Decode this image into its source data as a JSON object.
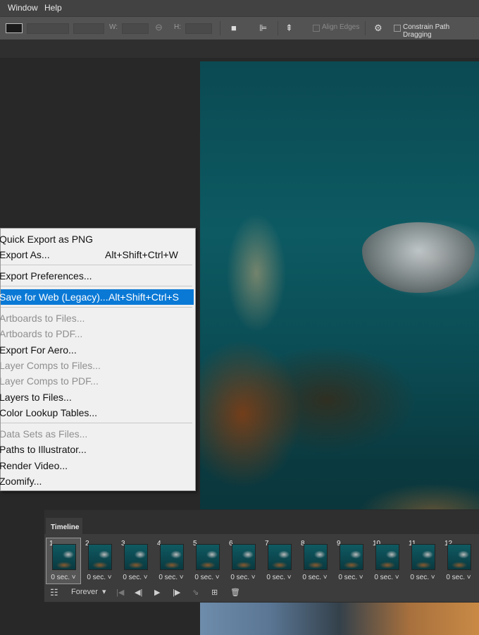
{
  "menubar": {
    "items": [
      "Window",
      "Help"
    ]
  },
  "options_bar": {
    "width_label": "W:",
    "height_label": "H:",
    "align_edges": "Align Edges",
    "constrain_path": "Constrain Path Dragging"
  },
  "export_menu": {
    "items": [
      {
        "label": "Quick Export as PNG",
        "shortcut": "",
        "state": "normal"
      },
      {
        "label": "Export As...",
        "shortcut": "Alt+Shift+Ctrl+W",
        "state": "normal"
      },
      {
        "label": "Export Preferences...",
        "shortcut": "",
        "state": "normal"
      },
      {
        "label": "Save for Web (Legacy)...",
        "shortcut": "Alt+Shift+Ctrl+S",
        "state": "highlighted"
      },
      {
        "label": "Artboards to Files...",
        "shortcut": "",
        "state": "disabled"
      },
      {
        "label": "Artboards to PDF...",
        "shortcut": "",
        "state": "disabled"
      },
      {
        "label": "Export For Aero...",
        "shortcut": "",
        "state": "normal"
      },
      {
        "label": "Layer Comps to Files...",
        "shortcut": "",
        "state": "disabled"
      },
      {
        "label": "Layer Comps to PDF...",
        "shortcut": "",
        "state": "disabled"
      },
      {
        "label": "Layers to Files...",
        "shortcut": "",
        "state": "normal"
      },
      {
        "label": "Color Lookup Tables...",
        "shortcut": "",
        "state": "normal"
      },
      {
        "label": "Data Sets as Files...",
        "shortcut": "",
        "state": "disabled"
      },
      {
        "label": "Paths to Illustrator...",
        "shortcut": "",
        "state": "normal"
      },
      {
        "label": "Render Video...",
        "shortcut": "",
        "state": "normal"
      },
      {
        "label": "Zoomify...",
        "shortcut": "",
        "state": "normal"
      }
    ]
  },
  "timeline": {
    "tab_label": "Timeline",
    "frames": [
      {
        "number": "1",
        "delay": "0 sec."
      },
      {
        "number": "2",
        "delay": "0 sec."
      },
      {
        "number": "3",
        "delay": "0 sec."
      },
      {
        "number": "4",
        "delay": "0 sec."
      },
      {
        "number": "5",
        "delay": "0 sec."
      },
      {
        "number": "6",
        "delay": "0 sec."
      },
      {
        "number": "7",
        "delay": "0 sec."
      },
      {
        "number": "8",
        "delay": "0 sec."
      },
      {
        "number": "9",
        "delay": "0 sec."
      },
      {
        "number": "10",
        "delay": "0 sec."
      },
      {
        "number": "11",
        "delay": "0 sec."
      },
      {
        "number": "12",
        "delay": "0 sec."
      }
    ],
    "loop_option": "Forever"
  },
  "colors": {
    "highlight": "#0a79d6",
    "menu_bg": "#f0f0f0",
    "canvas_teal": "#0d5a63"
  }
}
